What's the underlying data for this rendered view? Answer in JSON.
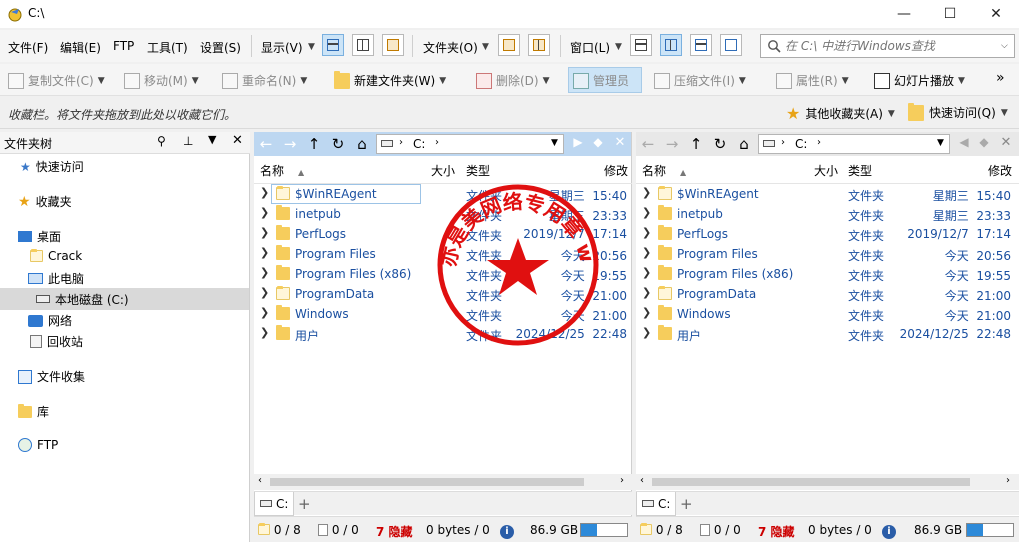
{
  "window": {
    "title": "C:\\",
    "minimize": "—",
    "maximize": "☐",
    "close": "✕"
  },
  "menu": {
    "file": "文件(F)",
    "edit": "编辑(E)",
    "ftp": "FTP",
    "tools": "工具(T)",
    "settings": "设置(S)",
    "display": "显示(V)",
    "folder": "文件夹(O)",
    "window": "窗口(L)"
  },
  "search": {
    "placeholder": "在 C:\\ 中进行Windows查找"
  },
  "toolbar": {
    "copy": "复制文件(C)",
    "move": "移动(M)",
    "rename": "重命名(N)",
    "new_folder": "新建文件夹(W)",
    "delete": "删除(D)",
    "admin": "管理员",
    "compress": "压缩文件(I)",
    "properties": "属性(R)",
    "slideshow": "幻灯片播放",
    "more": "»"
  },
  "favbar": {
    "hint": "收藏栏。将文件夹拖放到此处以收藏它们。",
    "other_favorites": "其他收藏夹(A)",
    "quick_access": "快速访问(Q)"
  },
  "tree": {
    "title": "文件夹树",
    "items": [
      {
        "label": "快速访问"
      },
      {
        "label": "收藏夹"
      },
      {
        "label": "桌面"
      },
      {
        "label": "Crack"
      },
      {
        "label": "此电脑"
      },
      {
        "label": "本地磁盘 (C:)"
      },
      {
        "label": "网络"
      },
      {
        "label": "回收站"
      },
      {
        "label": "文件收集"
      },
      {
        "label": "库"
      },
      {
        "label": "FTP"
      }
    ]
  },
  "pane_left": {
    "path": "C:",
    "columns": {
      "name": "名称",
      "size": "大小",
      "type": "类型",
      "modified": "修改"
    },
    "rows": [
      {
        "name": "$WinREAgent",
        "type": "文件夹",
        "date": "星期三  15:40"
      },
      {
        "name": "inetpub",
        "type": "文件夹",
        "date": "星期三  23:33"
      },
      {
        "name": "PerfLogs",
        "type": "文件夹",
        "date": "2019/12/7  17:14"
      },
      {
        "name": "Program Files",
        "type": "文件夹",
        "date": "今天  20:56"
      },
      {
        "name": "Program Files (x86)",
        "type": "文件夹",
        "date": "今天  19:55"
      },
      {
        "name": "ProgramData",
        "type": "文件夹",
        "date": "今天  21:00"
      },
      {
        "name": "Windows",
        "type": "文件夹",
        "date": "今天  21:00"
      },
      {
        "name": "用户",
        "type": "文件夹",
        "date": "2024/12/25  22:48"
      }
    ],
    "tab": "C:",
    "status": {
      "folders": "0 / 8",
      "files": "0 / 0",
      "hidden": "7 隐藏",
      "bytes": "0 bytes / 0",
      "free": "86.9 GB",
      "used_fraction": 0.35
    }
  },
  "pane_right": {
    "path": "C:",
    "columns": {
      "name": "名称",
      "size": "大小",
      "type": "类型",
      "modified": "修改"
    },
    "rows": [
      {
        "name": "$WinREAgent",
        "type": "文件夹",
        "date": "星期三  15:40"
      },
      {
        "name": "inetpub",
        "type": "文件夹",
        "date": "星期三  23:33"
      },
      {
        "name": "PerfLogs",
        "type": "文件夹",
        "date": "2019/12/7  17:14"
      },
      {
        "name": "Program Files",
        "type": "文件夹",
        "date": "今天  20:56"
      },
      {
        "name": "Program Files (x86)",
        "type": "文件夹",
        "date": "今天  19:55"
      },
      {
        "name": "ProgramData",
        "type": "文件夹",
        "date": "今天  21:00"
      },
      {
        "name": "Windows",
        "type": "文件夹",
        "date": "今天  21:00"
      },
      {
        "name": "用户",
        "type": "文件夹",
        "date": "2024/12/25  22:48"
      }
    ],
    "tab": "C:",
    "status": {
      "folders": "0 / 8",
      "files": "0 / 0",
      "hidden": "7 隐藏",
      "bytes": "0 bytes / 0",
      "free": "86.9 GB",
      "used_fraction": 0.35
    }
  },
  "stamp": {
    "text": "亦是美网络专用章 www.yishimei.cn"
  },
  "colors": {
    "accent": "#2d8ad9",
    "active_pane": "#bdd7f1",
    "hidden": "#cc0000",
    "stamp": "#e01010"
  }
}
